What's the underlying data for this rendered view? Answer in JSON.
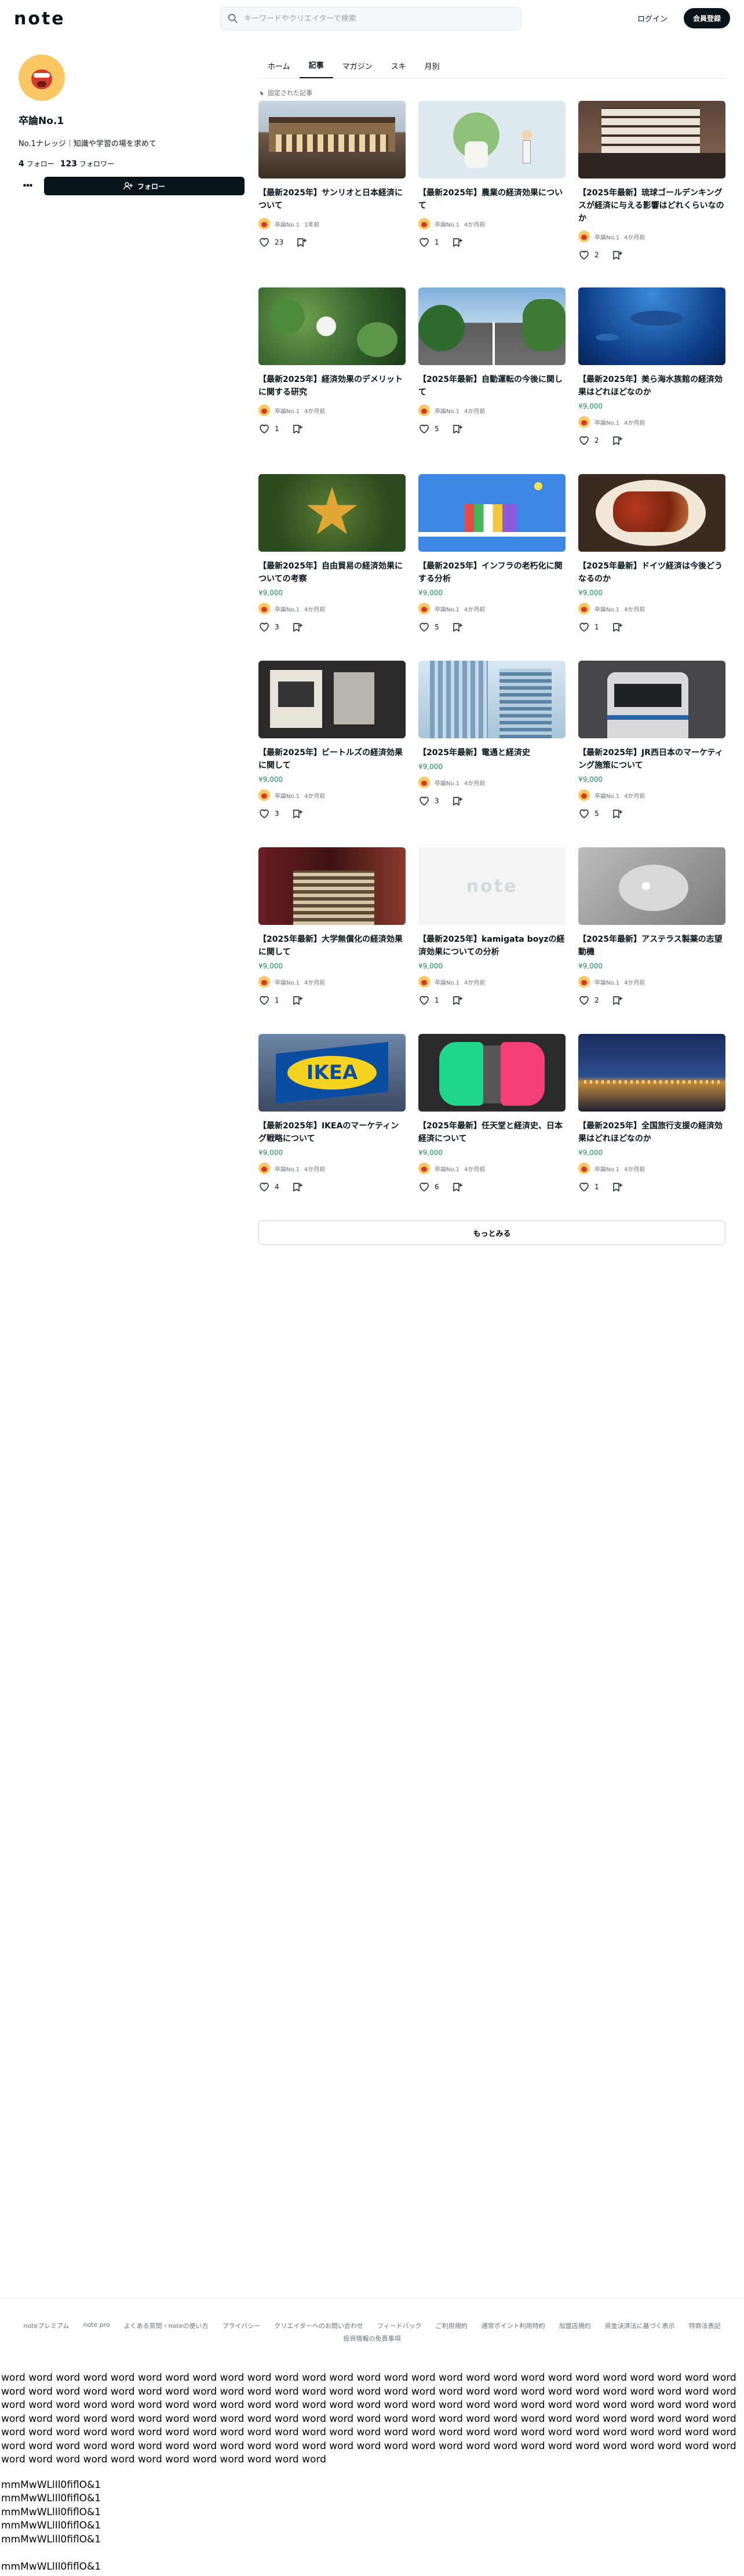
{
  "header": {
    "logo": "note",
    "search_placeholder": "キーワードやクリエイターで検索",
    "login": "ログイン",
    "signup": "会員登録"
  },
  "profile": {
    "name": "卒論No.1",
    "bio": "No.1ナレッジ｜知識や学習の場を求めて",
    "follow_count": "4",
    "follow_label": "フォロー",
    "follower_count": "123",
    "follower_label": "フォロワー",
    "follow_button": "フォロー",
    "more": "•••"
  },
  "tabs": [
    "ホーム",
    "記事",
    "マガジン",
    "スキ",
    "月別"
  ],
  "pinned_label": "固定された記事",
  "articles": [
    {
      "title": "【最新2025年】サンリオと日本経済について",
      "price": "",
      "author": "卒論No.1",
      "time": "1年前",
      "likes": "23",
      "thumb": "theater"
    },
    {
      "title": "【最新2025年】農業の経済効果について",
      "price": "",
      "author": "卒論No.1",
      "time": "4か月前",
      "likes": "1",
      "thumb": "vegetable"
    },
    {
      "title": "【2025年最新】琉球ゴールデンキングスが経済に与える影響はどれくらいなのか",
      "price": "",
      "author": "卒論No.1",
      "time": "4か月前",
      "likes": "2",
      "thumb": "building"
    },
    {
      "title": "【最新2025年】経済効果のデメリットに関する研究",
      "price": "",
      "author": "卒論No.1",
      "time": "4か月前",
      "likes": "1",
      "thumb": "leaves"
    },
    {
      "title": "【2025年最新】自動運転の今後に関して",
      "price": "",
      "author": "卒論No.1",
      "time": "4か月前",
      "likes": "5",
      "thumb": "street"
    },
    {
      "title": "【最新2025年】美ら海水族館の経済効果はどれほどなのか",
      "price": "¥9,000",
      "author": "卒論No.1",
      "time": "4か月前",
      "likes": "2",
      "thumb": "aquarium"
    },
    {
      "title": "【最新2025年】自由貿易の経済効果についての考察",
      "price": "¥9,000",
      "author": "卒論No.1",
      "time": "4か月前",
      "likes": "3",
      "thumb": "star"
    },
    {
      "title": "【最新2025年】インフラの老朽化に関する分析",
      "price": "¥9,000",
      "author": "卒論No.1",
      "time": "4か月前",
      "likes": "5",
      "thumb": "blue"
    },
    {
      "title": "【2025年最新】ドイツ経済は今後どうなるのか",
      "price": "¥9,000",
      "author": "卒論No.1",
      "time": "4か月前",
      "likes": "1",
      "thumb": "food"
    },
    {
      "title": "【最新2025年】ビートルズの経済効果に関して",
      "price": "¥9,000",
      "author": "卒論No.1",
      "time": "4か月前",
      "likes": "3",
      "thumb": "shop"
    },
    {
      "title": "【2025年最新】電通と経済史",
      "price": "¥9,000",
      "author": "卒論No.1",
      "time": "4か月前",
      "likes": "3",
      "thumb": "glass"
    },
    {
      "title": "【最新2025年】JR西日本のマーケティング施策について",
      "price": "¥9,000",
      "author": "卒論No.1",
      "time": "4か月前",
      "likes": "5",
      "thumb": "train"
    },
    {
      "title": "【2025年最新】大学無償化の経済効果に関して",
      "price": "¥9,000",
      "author": "卒論No.1",
      "time": "4か月前",
      "likes": "1",
      "thumb": "stairs"
    },
    {
      "title": "【最新2025年】kamigata boyzの経済効果についての分析",
      "price": "¥9,000",
      "author": "卒論No.1",
      "time": "4か月前",
      "likes": "1",
      "thumb": "note"
    },
    {
      "title": "【2025年最新】アステラス製薬の志望動機",
      "price": "¥9,000",
      "author": "卒論No.1",
      "time": "4か月前",
      "likes": "2",
      "thumb": "pill"
    },
    {
      "title": "【最新2025年】IKEAのマーケティング戦略について",
      "price": "¥9,000",
      "author": "卒論No.1",
      "time": "4か月前",
      "likes": "4",
      "thumb": "ikea"
    },
    {
      "title": "【2025年最新】任天堂と経済史、日本経済について",
      "price": "¥9,000",
      "author": "卒論No.1",
      "time": "4か月前",
      "likes": "6",
      "thumb": "switch"
    },
    {
      "title": "【最新2025年】全国旅行支援の経済効果はどれほどなのか",
      "price": "¥9,000",
      "author": "卒論No.1",
      "time": "4か月前",
      "likes": "1",
      "thumb": "night"
    }
  ],
  "thumb_text": {
    "note": "note",
    "ikea": "IKEA"
  },
  "more_button": "もっとみる",
  "footer_links": [
    "noteプレミアム",
    "note pro",
    "よくある質問・noteの使い方",
    "プライバシー",
    "クリエイターへのお問い合わせ",
    "フィードバック",
    "ご利用規約",
    "通常ポイント利用特約",
    "加盟店規約",
    "資金決済法に基づく表示",
    "特商法表記",
    "投資情報の免責事項"
  ],
  "debug_words": "word word word word word word word word word word word word word word word word word word word word word word word word word word word word word word word word word word word word word word word word word word word word word word word word word word word word word word word word word word word word word word word word word word word word word word word word word word word word word word word word word word word word word word word word word word word word word word word word word word word word word word word word word word word word word word word word word word word word word word word word word word word word word word word word word word word word word word word word word word word word word word word word word word word word word word word word word word word word word word word word word word word word word word word word word word word word word word",
  "debug_lines": [
    "mmMwWLlIl0fiflO&1",
    "mmMwWLlIl0fiflO&1",
    "mmMwWLlIl0fiflO&1",
    "mmMwWLlIl0fiflO&1",
    "mmMwWLlIl0fiflO&1",
    "",
    "mmMwWLlIl0fiflO&1"
  ]
}
